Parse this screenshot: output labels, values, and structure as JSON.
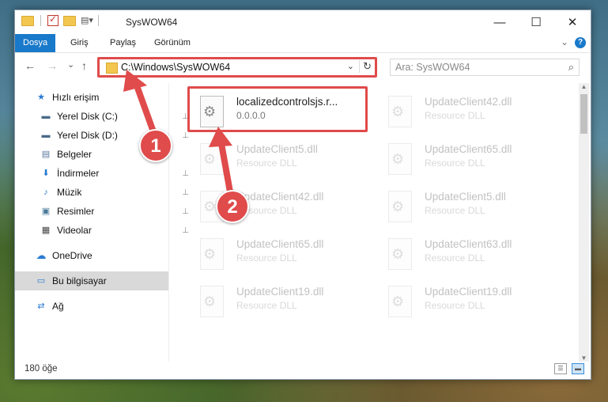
{
  "window": {
    "title": "SysWOW64",
    "minimize": "—",
    "maximize": "☐",
    "close": "✕"
  },
  "ribbon": {
    "tabs": [
      "Dosya",
      "Giriş",
      "Paylaş",
      "Görünüm"
    ],
    "help": "?",
    "expand": "⌄"
  },
  "nav": {
    "back": "←",
    "forward": "→",
    "recent": "⌄",
    "up": "↑",
    "address": "C:\\Windows\\SysWOW64",
    "dropdown": "⌄",
    "refresh": "↻",
    "search_placeholder": "Ara: SysWOW64",
    "search_icon": "⌕"
  },
  "sidebar": {
    "items": [
      {
        "label": "Hızlı erişim",
        "icon": "star-icon",
        "glyph": "★",
        "color": "#2a7ad2"
      },
      {
        "label": "Yerel Disk (C:)",
        "icon": "drive-icon",
        "glyph": "▬",
        "color": "#4a6a8a",
        "pin": "📌"
      },
      {
        "label": "Yerel Disk (D:)",
        "icon": "drive-icon",
        "glyph": "▬",
        "color": "#4a6a8a",
        "pin": "📌"
      },
      {
        "label": "Belgeler",
        "icon": "documents-icon",
        "glyph": "▤",
        "color": "#5a7aa0",
        "pin": "📌"
      },
      {
        "label": "İndirmeler",
        "icon": "download-icon",
        "glyph": "⬇",
        "color": "#2a7ad2",
        "pin": "📌"
      },
      {
        "label": "Müzik",
        "icon": "music-icon",
        "glyph": "♪",
        "color": "#2a7ad2",
        "pin": "📌"
      },
      {
        "label": "Resimler",
        "icon": "pictures-icon",
        "glyph": "▣",
        "color": "#4a7a9a",
        "pin": "📌"
      },
      {
        "label": "Videolar",
        "icon": "videos-icon",
        "glyph": "▦",
        "color": "#444",
        "pin": "📌"
      },
      {
        "label": "OneDrive",
        "icon": "cloud-icon",
        "glyph": "☁",
        "color": "#2a7ad2"
      },
      {
        "label": "Bu bilgisayar",
        "icon": "computer-icon",
        "glyph": "▭",
        "color": "#2a7ad2"
      },
      {
        "label": "Ağ",
        "icon": "network-icon",
        "glyph": "⇄",
        "color": "#2a7ad2"
      }
    ]
  },
  "files": [
    {
      "name": "localizedcontrolsjs.r...",
      "sub": "0.0.0.0"
    },
    {
      "name": "UpdateClient42.dll",
      "sub": "Resource DLL"
    },
    {
      "name": "UpdateClient5.dll",
      "sub": "Resource DLL"
    },
    {
      "name": "UpdateClient65.dll",
      "sub": "Resource DLL"
    },
    {
      "name": "UpdateClient42.dll",
      "sub": "Resource DLL"
    },
    {
      "name": "UpdateClient5.dll",
      "sub": "Resource DLL"
    },
    {
      "name": "UpdateClient65.dll",
      "sub": "Resource DLL"
    },
    {
      "name": "UpdateClient63.dll",
      "sub": "Resource DLL"
    },
    {
      "name": "UpdateClient19.dll",
      "sub": "Resource DLL"
    },
    {
      "name": "UpdateClient19.dll",
      "sub": "Resource DLL"
    }
  ],
  "status": {
    "count": "180 öğe"
  },
  "callouts": [
    "1",
    "2"
  ],
  "colors": {
    "accent": "#1979ca",
    "highlight": "#e04b4b"
  }
}
